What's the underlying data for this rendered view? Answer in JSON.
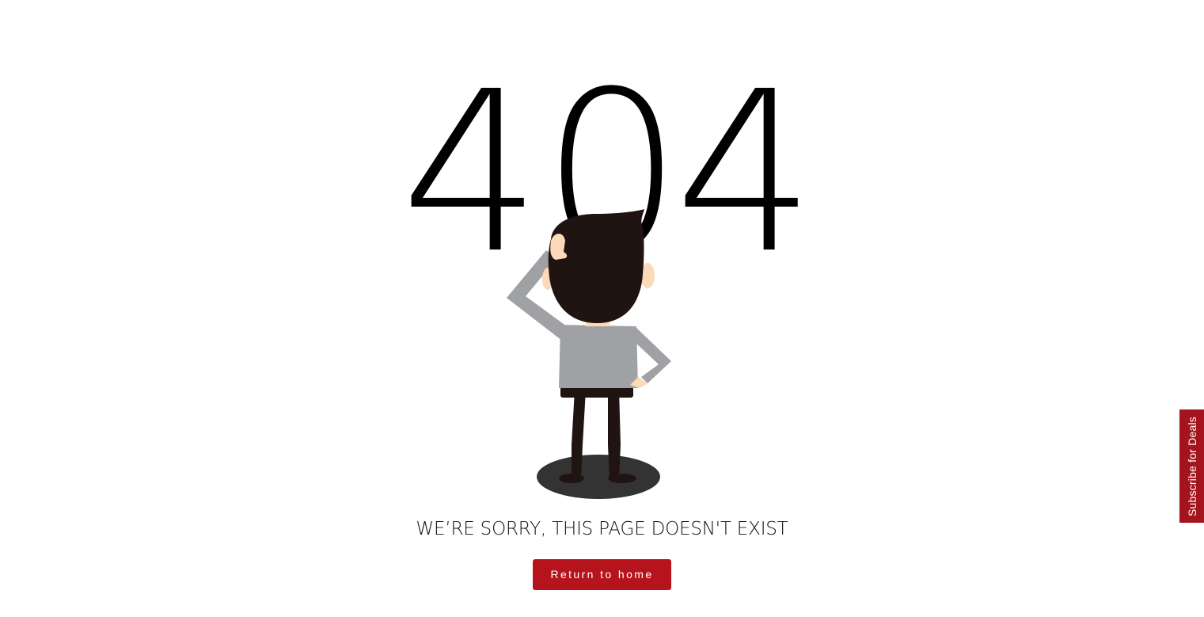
{
  "error": {
    "digit_1": "4",
    "digit_2": "0",
    "digit_3": "4"
  },
  "message": "WE’RE SORRY, THIS PAGE DOESN'T EXIST",
  "button": {
    "return_label": "Return to home"
  },
  "subscribe": {
    "label": "Subscribe for Deals"
  },
  "colors": {
    "accent": "#b5141d",
    "tab": "#a3141c",
    "hair": "#1f1411",
    "shirt": "#a0a1a5",
    "skin": "#fbd9b9",
    "shadow": "#333333"
  },
  "icons": {
    "illustration": "confused-man-illustration"
  }
}
